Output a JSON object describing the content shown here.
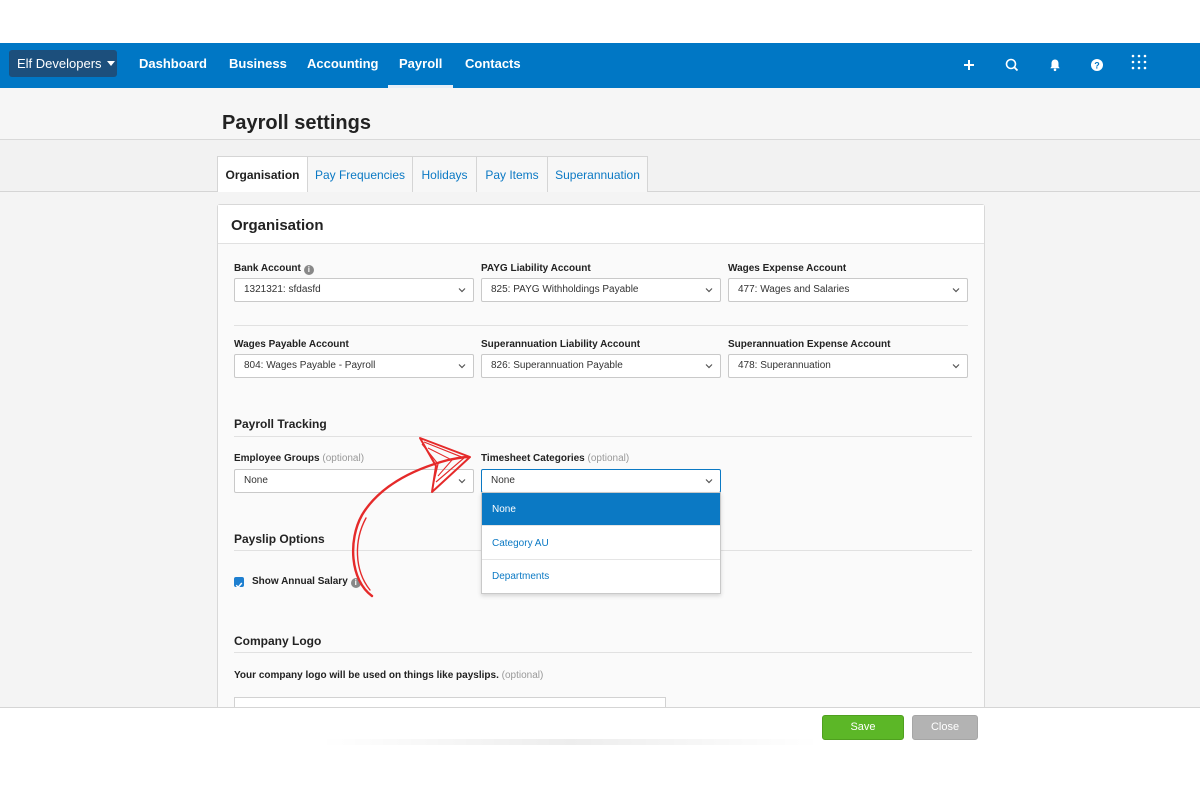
{
  "nav": {
    "org_name": "Elf Developers",
    "items": [
      {
        "label": "Dashboard"
      },
      {
        "label": "Business"
      },
      {
        "label": "Accounting"
      },
      {
        "label": "Payroll",
        "active": true
      },
      {
        "label": "Contacts"
      }
    ],
    "icons": [
      "plus-icon",
      "search-icon",
      "bell-icon",
      "help-icon",
      "apps-grid-icon"
    ]
  },
  "page": {
    "title": "Payroll settings"
  },
  "tabs": [
    {
      "label": "Organisation",
      "active": true
    },
    {
      "label": "Pay Frequencies"
    },
    {
      "label": "Holidays"
    },
    {
      "label": "Pay Items"
    },
    {
      "label": "Superannuation"
    }
  ],
  "panel": {
    "title": "Organisation"
  },
  "accounts": {
    "bank": {
      "label": "Bank Account",
      "value": "1321321: sfdasfd"
    },
    "payg": {
      "label": "PAYG Liability Account",
      "value": "825: PAYG Withholdings Payable"
    },
    "wages_expense": {
      "label": "Wages Expense Account",
      "value": "477: Wages and Salaries"
    },
    "wages_payable": {
      "label": "Wages Payable Account",
      "value": "804: Wages Payable - Payroll"
    },
    "super_liability": {
      "label": "Superannuation Liability Account",
      "value": "826: Superannuation Payable"
    },
    "super_expense": {
      "label": "Superannuation Expense Account",
      "value": "478: Superannuation"
    }
  },
  "tracking": {
    "title": "Payroll Tracking",
    "employee_groups": {
      "label": "Employee Groups",
      "optional": "(optional)",
      "value": "None"
    },
    "timesheet_categories": {
      "label": "Timesheet Categories",
      "optional": "(optional)",
      "value": "None"
    },
    "dropdown_options": [
      "None",
      "Category AU",
      "Departments"
    ]
  },
  "payslip": {
    "title": "Payslip Options",
    "show_annual_salary": {
      "label": "Show Annual Salary",
      "checked": true
    }
  },
  "logo": {
    "title": "Company Logo",
    "note": "Your company logo will be used on things like payslips.",
    "optional": "(optional)"
  },
  "footer": {
    "save_label": "Save",
    "close_label": "Close"
  },
  "colors": {
    "nav_bg": "#0077c5",
    "org_btn_bg": "#1c4f7c",
    "link_blue": "#0b79c4",
    "save_green": "#5cb727",
    "close_grey": "#b3b3b3",
    "annotation_red": "#e52a2a"
  }
}
